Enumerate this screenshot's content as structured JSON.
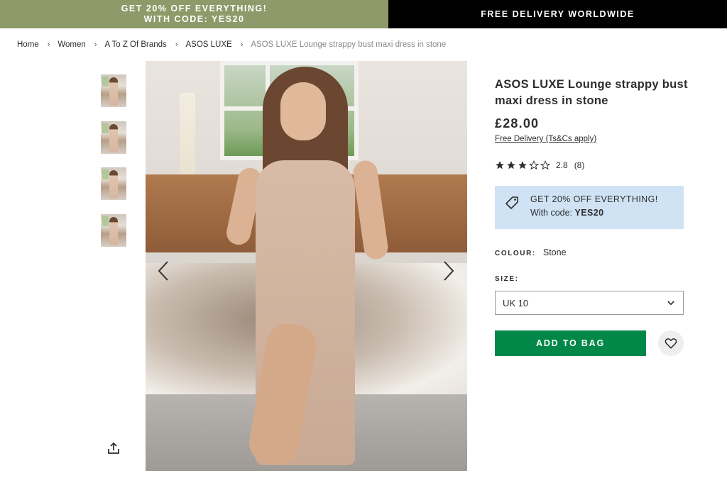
{
  "banners": {
    "left_line1": "GET 20% OFF EVERYTHING!",
    "left_line2": "WITH CODE: YES20",
    "right": "FREE DELIVERY WORLDWIDE",
    "left_color": "#8f9a6a",
    "right_color": "#000000"
  },
  "breadcrumb": {
    "items": [
      "Home",
      "Women",
      "A To Z Of Brands",
      "ASOS LUXE"
    ],
    "current": "ASOS LUXE Lounge strappy bust maxi dress in stone",
    "separator": "›"
  },
  "gallery": {
    "thumbnail_count": 4,
    "prev_icon": "chevron-left-icon",
    "next_icon": "chevron-right-icon",
    "share_icon": "share-icon"
  },
  "product": {
    "title": "ASOS LUXE Lounge strappy bust maxi dress in stone",
    "price": "£28.00",
    "delivery_link": "Free Delivery (Ts&Cs apply)",
    "rating": {
      "value": "2.8",
      "count": "(8)",
      "stars_filled": 3,
      "stars_total": 5
    },
    "promo": {
      "line1": "GET 20% OFF EVERYTHING!",
      "line2_prefix": "With code: ",
      "code": "YES20",
      "icon": "tag-icon",
      "background": "#cfe3f5"
    },
    "colour_label": "COLOUR:",
    "colour_value": "Stone",
    "size_label": "SIZE:",
    "size_selected": "UK 10",
    "add_to_bag": "ADD TO BAG",
    "add_to_bag_color": "#018849",
    "wishlist_icon": "heart-icon"
  }
}
